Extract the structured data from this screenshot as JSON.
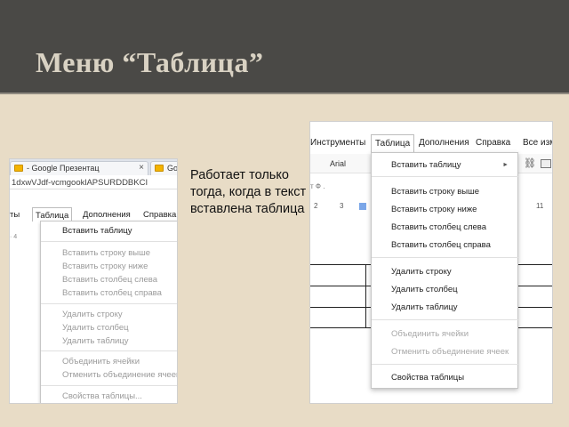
{
  "slide": {
    "title": "Меню “Таблица”",
    "body_text": "Работает только тогда, когда в текст вставлена таблица"
  },
  "left_screenshot": {
    "browser_tabs": [
      {
        "label": "- Google Презентац",
        "close": "×",
        "icon": "slides-favicon-icon"
      },
      {
        "label": "Goo",
        "icon": "slides-favicon-icon"
      }
    ],
    "address_text": "1dxwVJdf-vcmgooklAPSURDDBKCI",
    "menubar": [
      "ты",
      "Таблица",
      "Дополнения",
      "Справка"
    ],
    "active_menu": "Таблица",
    "ruler_text": "· 4",
    "menu_items": [
      {
        "label": "Вставить таблицу",
        "enabled": true,
        "submenu": true
      },
      {
        "label": "Вставить строку выше",
        "enabled": false
      },
      {
        "label": "Вставить строку ниже",
        "enabled": false
      },
      {
        "label": "Вставить столбец слева",
        "enabled": false
      },
      {
        "label": "Вставить столбец справа",
        "enabled": false
      },
      {
        "label": "Удалить строку",
        "enabled": false
      },
      {
        "label": "Удалить столбец",
        "enabled": false
      },
      {
        "label": "Удалить таблицу",
        "enabled": false
      },
      {
        "label": "Объединить ячейки",
        "enabled": false
      },
      {
        "label": "Отменить объединение ячеек",
        "enabled": false
      },
      {
        "label": "Свойства таблицы...",
        "enabled": false
      }
    ]
  },
  "right_screenshot": {
    "menubar": [
      "Инструменты",
      "Таблица",
      "Дополнения",
      "Справка",
      "Все изм"
    ],
    "active_menu": "Таблица",
    "toolbar": {
      "font": "Arial",
      "link_icon": "link-icon",
      "comment_icon": "comment-icon"
    },
    "row2_text": "т Ф .",
    "ruler": [
      "2",
      "3",
      "11"
    ],
    "menu_items": [
      {
        "label": "Вставить таблицу",
        "enabled": true,
        "submenu": true,
        "arrow": "►"
      },
      {
        "label": "Вставить строку выше",
        "enabled": true
      },
      {
        "label": "Вставить строку ниже",
        "enabled": true
      },
      {
        "label": "Вставить столбец слева",
        "enabled": true
      },
      {
        "label": "Вставить столбец справа",
        "enabled": true
      },
      {
        "label": "Удалить строку",
        "enabled": true
      },
      {
        "label": "Удалить столбец",
        "enabled": true
      },
      {
        "label": "Удалить таблицу",
        "enabled": true
      },
      {
        "label": "Объединить ячейки",
        "enabled": false
      },
      {
        "label": "Отменить объединение ячеек",
        "enabled": false
      },
      {
        "label": "Свойства таблицы",
        "enabled": true
      }
    ]
  }
}
